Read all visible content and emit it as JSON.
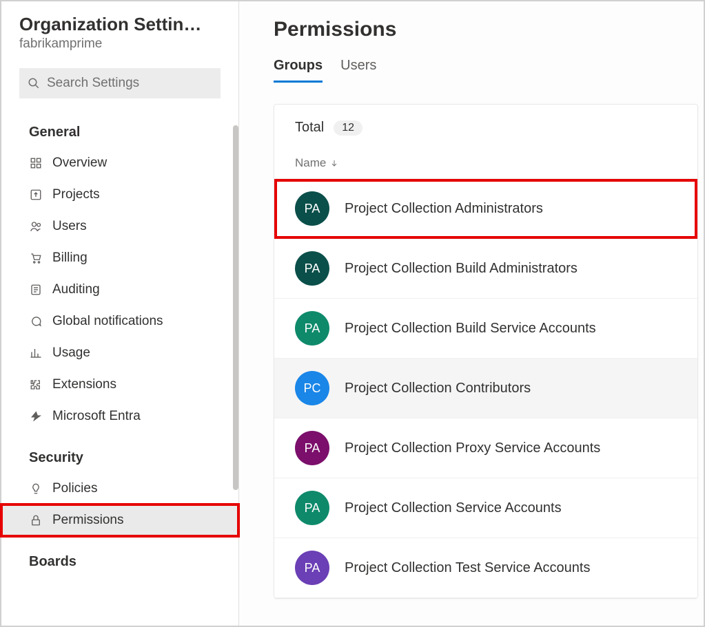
{
  "sidebar": {
    "title": "Organization Settin…",
    "org": "fabrikamprime",
    "search_placeholder": "Search Settings",
    "sections": [
      {
        "title": "General",
        "items": [
          {
            "icon": "grid-icon",
            "label": "Overview"
          },
          {
            "icon": "upload-icon",
            "label": "Projects"
          },
          {
            "icon": "users-icon",
            "label": "Users"
          },
          {
            "icon": "cart-icon",
            "label": "Billing"
          },
          {
            "icon": "list-icon",
            "label": "Auditing"
          },
          {
            "icon": "chat-icon",
            "label": "Global notifications"
          },
          {
            "icon": "chart-icon",
            "label": "Usage"
          },
          {
            "icon": "puzzle-icon",
            "label": "Extensions"
          },
          {
            "icon": "entra-icon",
            "label": "Microsoft Entra"
          }
        ]
      },
      {
        "title": "Security",
        "items": [
          {
            "icon": "bulb-icon",
            "label": "Policies"
          },
          {
            "icon": "lock-icon",
            "label": "Permissions",
            "active": true,
            "highlight": true
          }
        ]
      },
      {
        "title": "Boards",
        "items": []
      }
    ]
  },
  "main": {
    "title": "Permissions",
    "tabs": [
      {
        "label": "Groups",
        "active": true
      },
      {
        "label": "Users"
      }
    ],
    "total_label": "Total",
    "total_count": "12",
    "column_label": "Name",
    "groups": [
      {
        "initials": "PA",
        "color": "#0b4f4a",
        "name": "Project Collection Administrators",
        "highlight": true
      },
      {
        "initials": "PA",
        "color": "#0b4f4a",
        "name": "Project Collection Build Administrators"
      },
      {
        "initials": "PA",
        "color": "#0e8a6b",
        "name": "Project Collection Build Service Accounts"
      },
      {
        "initials": "PC",
        "color": "#1a86e8",
        "name": "Project Collection Contributors",
        "hover": true
      },
      {
        "initials": "PA",
        "color": "#7b0f6b",
        "name": "Project Collection Proxy Service Accounts"
      },
      {
        "initials": "PA",
        "color": "#0e8a6b",
        "name": "Project Collection Service Accounts"
      },
      {
        "initials": "PA",
        "color": "#6b3fb5",
        "name": "Project Collection Test Service Accounts"
      }
    ]
  }
}
